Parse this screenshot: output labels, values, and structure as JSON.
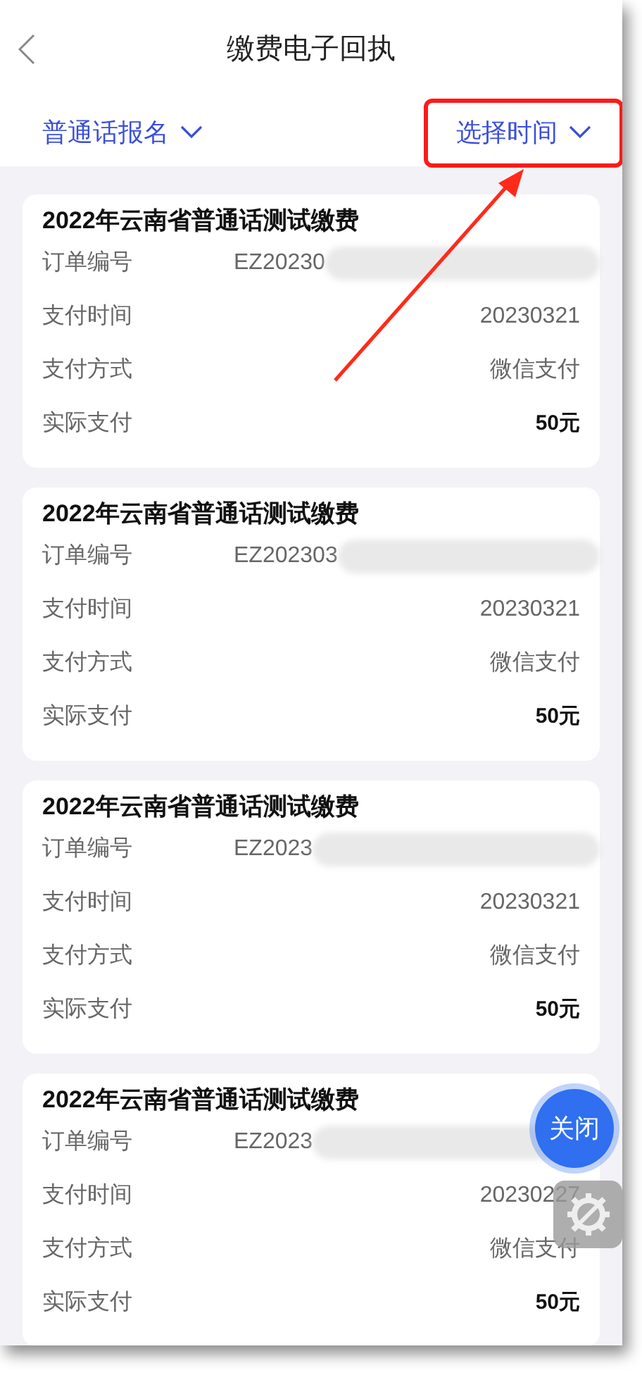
{
  "header": {
    "title": "缴费电子回执"
  },
  "filters": [
    {
      "label": "普通话报名",
      "highlighted": false
    },
    {
      "label": "选择时间",
      "highlighted": true
    }
  ],
  "receipts": [
    {
      "title": "2022年云南省普通话测试缴费",
      "rows": [
        {
          "label": "订单编号",
          "value": "EZ20230",
          "kind": "redacted"
        },
        {
          "label": "支付时间",
          "value": "20230321",
          "kind": "plain"
        },
        {
          "label": "支付方式",
          "value": "微信支付",
          "kind": "plain"
        },
        {
          "label": "实际支付",
          "value": "50元",
          "kind": "total"
        }
      ]
    },
    {
      "title": "2022年云南省普通话测试缴费",
      "rows": [
        {
          "label": "订单编号",
          "value": "EZ202303",
          "kind": "redacted"
        },
        {
          "label": "支付时间",
          "value": "20230321",
          "kind": "plain"
        },
        {
          "label": "支付方式",
          "value": "微信支付",
          "kind": "plain"
        },
        {
          "label": "实际支付",
          "value": "50元",
          "kind": "total"
        }
      ]
    },
    {
      "title": "2022年云南省普通话测试缴费",
      "rows": [
        {
          "label": "订单编号",
          "value": "EZ2023",
          "kind": "redacted"
        },
        {
          "label": "支付时间",
          "value": "20230321",
          "kind": "plain"
        },
        {
          "label": "支付方式",
          "value": "微信支付",
          "kind": "plain"
        },
        {
          "label": "实际支付",
          "value": "50元",
          "kind": "total"
        }
      ]
    },
    {
      "title": "2022年云南省普通话测试缴费",
      "rows": [
        {
          "label": "订单编号",
          "value": "EZ2023",
          "kind": "redacted"
        },
        {
          "label": "支付时间",
          "value": "20230227",
          "kind": "plain"
        },
        {
          "label": "支付方式",
          "value": "微信支付",
          "kind": "plain"
        },
        {
          "label": "实际支付",
          "value": "50元",
          "kind": "total"
        }
      ]
    }
  ],
  "floating": {
    "close_button": "关闭"
  }
}
